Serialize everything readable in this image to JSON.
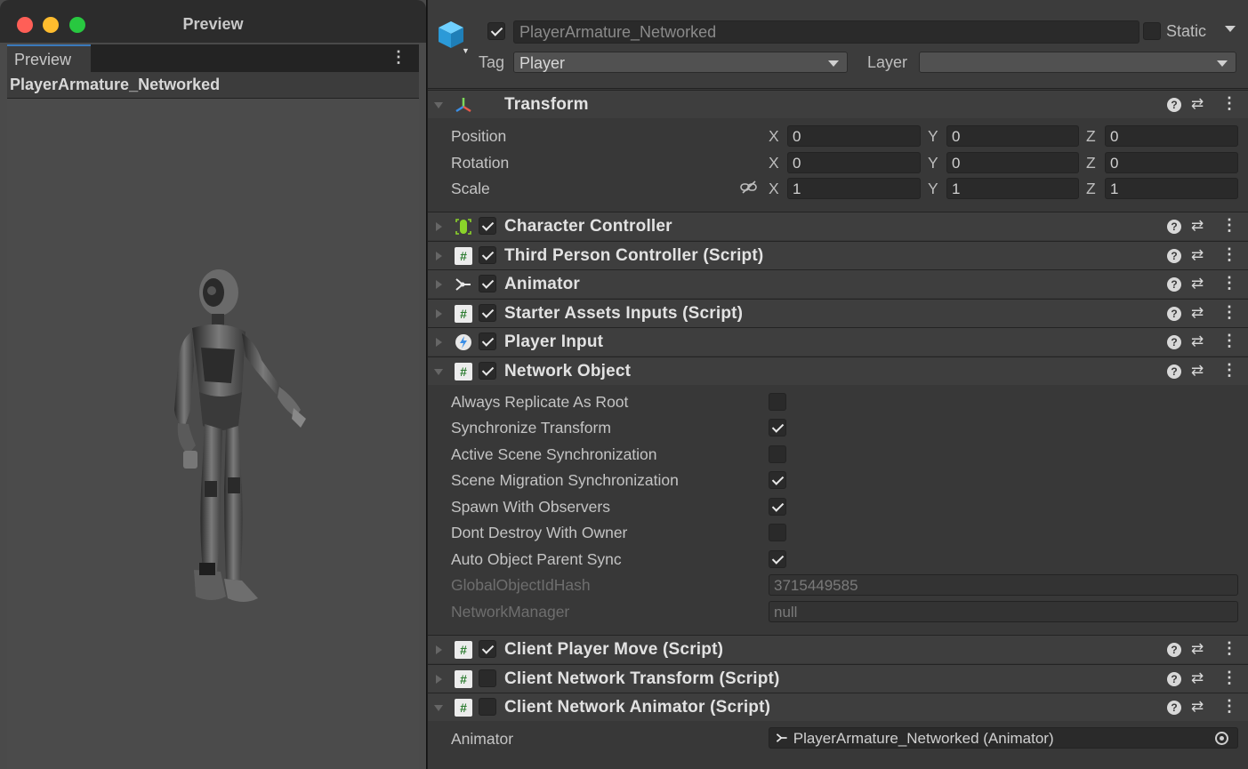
{
  "preview_window": {
    "title": "Preview",
    "tab_label": "Preview",
    "menu_glyph": "⋮",
    "object_name": "PlayerArmature_Networked"
  },
  "inspector": {
    "object_name": "PlayerArmature_Networked",
    "object_active": true,
    "static_label": "Static",
    "tag_label": "Tag",
    "tag_value": "Player",
    "layer_label": "Layer",
    "layer_value": "",
    "transform": {
      "title": "Transform",
      "rows": [
        {
          "label": "Position",
          "x": "0",
          "y": "0",
          "z": "0"
        },
        {
          "label": "Rotation",
          "x": "0",
          "y": "0",
          "z": "0"
        },
        {
          "label": "Scale",
          "x": "1",
          "y": "1",
          "z": "1"
        }
      ],
      "axes": {
        "x": "X",
        "y": "Y",
        "z": "Z"
      }
    },
    "components": {
      "character_controller": {
        "title": "Character Controller",
        "enabled": true
      },
      "third_person_controller": {
        "title": "Third Person Controller (Script)",
        "enabled": true
      },
      "animator": {
        "title": "Animator",
        "enabled": true
      },
      "starter_assets_inputs": {
        "title": "Starter Assets Inputs (Script)",
        "enabled": true
      },
      "player_input": {
        "title": "Player Input",
        "enabled": true
      },
      "network_object": {
        "title": "Network Object",
        "enabled": true
      },
      "client_player_move": {
        "title": "Client Player Move (Script)",
        "enabled": true
      },
      "client_network_transform": {
        "title": "Client Network Transform (Script)",
        "enabled": false
      },
      "client_network_animator": {
        "title": "Client Network Animator (Script)",
        "enabled": false
      }
    },
    "network_object_props": {
      "always_replicate_as_root": {
        "label": "Always Replicate As Root",
        "checked": false
      },
      "synchronize_transform": {
        "label": "Synchronize Transform",
        "checked": true
      },
      "active_scene_synchronization": {
        "label": "Active Scene Synchronization",
        "checked": false
      },
      "scene_migration_synchronization": {
        "label": "Scene Migration Synchronization",
        "checked": true
      },
      "spawn_with_observers": {
        "label": "Spawn With Observers",
        "checked": true
      },
      "dont_destroy_with_owner": {
        "label": "Dont Destroy With Owner",
        "checked": false
      },
      "auto_object_parent_sync": {
        "label": "Auto Object Parent Sync",
        "checked": true
      },
      "global_object_id_hash": {
        "label": "GlobalObjectIdHash",
        "value": "3715449585"
      },
      "network_manager": {
        "label": "NetworkManager",
        "value": "null"
      }
    },
    "client_network_animator_props": {
      "animator_label": "Animator",
      "animator_value": "PlayerArmature_Networked (Animator)"
    },
    "header_glyphs": {
      "help": "?",
      "preset": "⇄",
      "menu": "⋮"
    }
  },
  "colors": {
    "accent_tab": "#3a79bb",
    "script_icon_green": "#2e7d32",
    "controller_icon_green": "#8bd32a"
  }
}
